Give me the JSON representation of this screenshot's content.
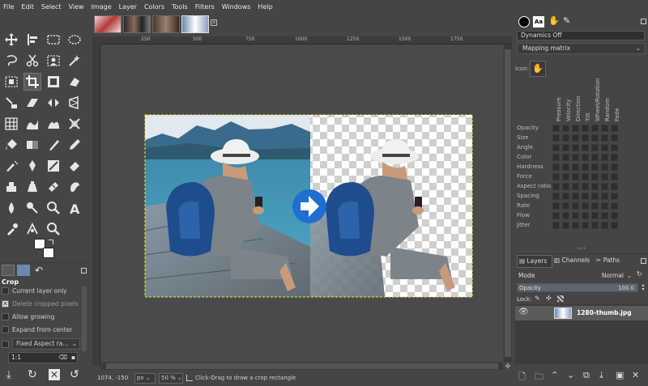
{
  "menu": [
    "File",
    "Edit",
    "Select",
    "View",
    "Image",
    "Layer",
    "Colors",
    "Tools",
    "Filters",
    "Windows",
    "Help"
  ],
  "ruler": {
    "h_ticks": [
      "250",
      "500",
      "750",
      "1000",
      "1250",
      "1500",
      "1750"
    ]
  },
  "tool_options": {
    "title": "Crop",
    "current_layer_only": "Current layer only",
    "delete_cropped_pixels": "Delete cropped pixels",
    "allow_growing": "Allow growing",
    "expand_from_center": "Expand from center",
    "fixed_aspect": "Fixed Aspect ra...",
    "ratio_value": "1:1"
  },
  "status": {
    "coords": "1074, -150",
    "unit": "px",
    "zoom": "50 %",
    "message": "Click-Drag to draw a crop rectangle"
  },
  "dynamics": {
    "selected": "Dynamics Off",
    "mapping": "Mapping matrix",
    "icon_label": "Icon:",
    "inputs": [
      "Pressure",
      "Velocity",
      "Direction",
      "Tilt",
      "Wheel/Rotation",
      "Random",
      "Fade"
    ],
    "outputs": [
      "Opacity",
      "Size",
      "Angle",
      "Color",
      "Hardness",
      "Force",
      "Aspect ratio",
      "Spacing",
      "Rate",
      "Flow",
      "Jitter"
    ]
  },
  "layers": {
    "tabs": {
      "layers": "Layers",
      "channels": "Channels",
      "paths": "Paths"
    },
    "mode_label": "Mode",
    "mode_value": "Normal",
    "opacity_label": "Opacity",
    "opacity_value": "100.0",
    "lock_label": "Lock:",
    "items": [
      {
        "name": "1280-thumb.jpg"
      }
    ]
  },
  "colors": {
    "accent": "#1f6fd0",
    "selection": "#f5e54a"
  }
}
